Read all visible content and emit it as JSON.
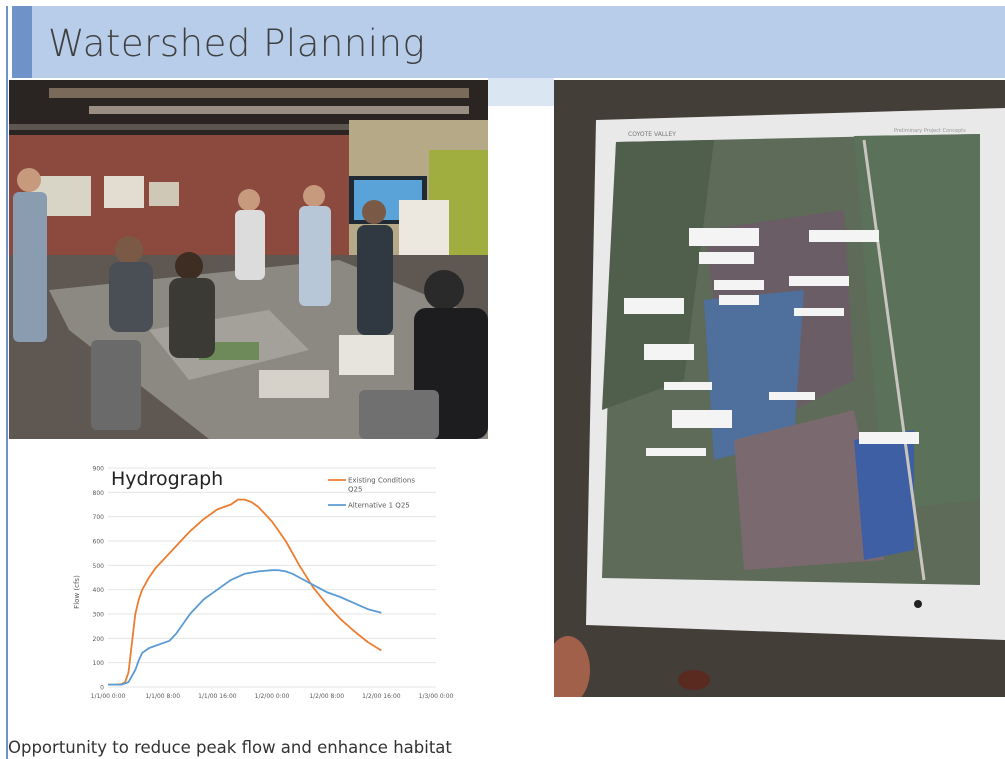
{
  "slide": {
    "title": "Watershed Planning",
    "caption": "Opportunity to reduce peak flow and enhance habitat",
    "colors": {
      "title_bar": "#b7cdea",
      "accent": "#6f93c8"
    }
  },
  "meeting_photo": {
    "subject": "workshop-meeting-photo"
  },
  "map_photo": {
    "header": "COYOTE VALLEY",
    "header_right": "Preliminary Project Concepts"
  },
  "chart_data": {
    "type": "line",
    "title": "Hydrograph",
    "xlabel": "",
    "ylabel": "Flow (cfs)",
    "ylim": [
      0,
      900
    ],
    "yticks": [
      0,
      100,
      200,
      300,
      400,
      500,
      600,
      700,
      800,
      900
    ],
    "xticks": [
      "1/1/00 0:00",
      "1/1/00 8:00",
      "1/1/00 16:00",
      "1/2/00 0:00",
      "1/2/00 8:00",
      "1/2/00 16:00",
      "1/3/00 0:00"
    ],
    "xlim": [
      0,
      48
    ],
    "grid": true,
    "legend": "top-right",
    "series": [
      {
        "name": "Existing Conditions Q25",
        "color": "#ed7d31",
        "x": [
          0,
          1,
          2,
          2.5,
          3,
          3.5,
          4,
          4.5,
          5,
          6,
          7,
          8,
          10,
          12,
          14,
          16,
          18,
          19,
          20,
          21,
          22,
          24,
          26,
          28,
          30,
          32,
          34,
          36,
          38,
          40
        ],
        "y": [
          10,
          10,
          12,
          20,
          60,
          180,
          300,
          360,
          400,
          450,
          490,
          520,
          580,
          640,
          690,
          730,
          750,
          770,
          770,
          760,
          740,
          680,
          600,
          500,
          410,
          340,
          280,
          230,
          185,
          150
        ]
      },
      {
        "name": "Alternative 1 Q25",
        "color": "#5b9bd5",
        "x": [
          0,
          2,
          3,
          4,
          4.5,
          5,
          6,
          7,
          8,
          9,
          10,
          12,
          14,
          16,
          18,
          20,
          22,
          24,
          25,
          26,
          27,
          28,
          30,
          32,
          34,
          36,
          38,
          40
        ],
        "y": [
          10,
          10,
          20,
          70,
          110,
          140,
          160,
          170,
          180,
          190,
          220,
          300,
          360,
          400,
          440,
          465,
          475,
          480,
          480,
          475,
          465,
          450,
          420,
          390,
          370,
          345,
          320,
          305
        ]
      }
    ]
  }
}
